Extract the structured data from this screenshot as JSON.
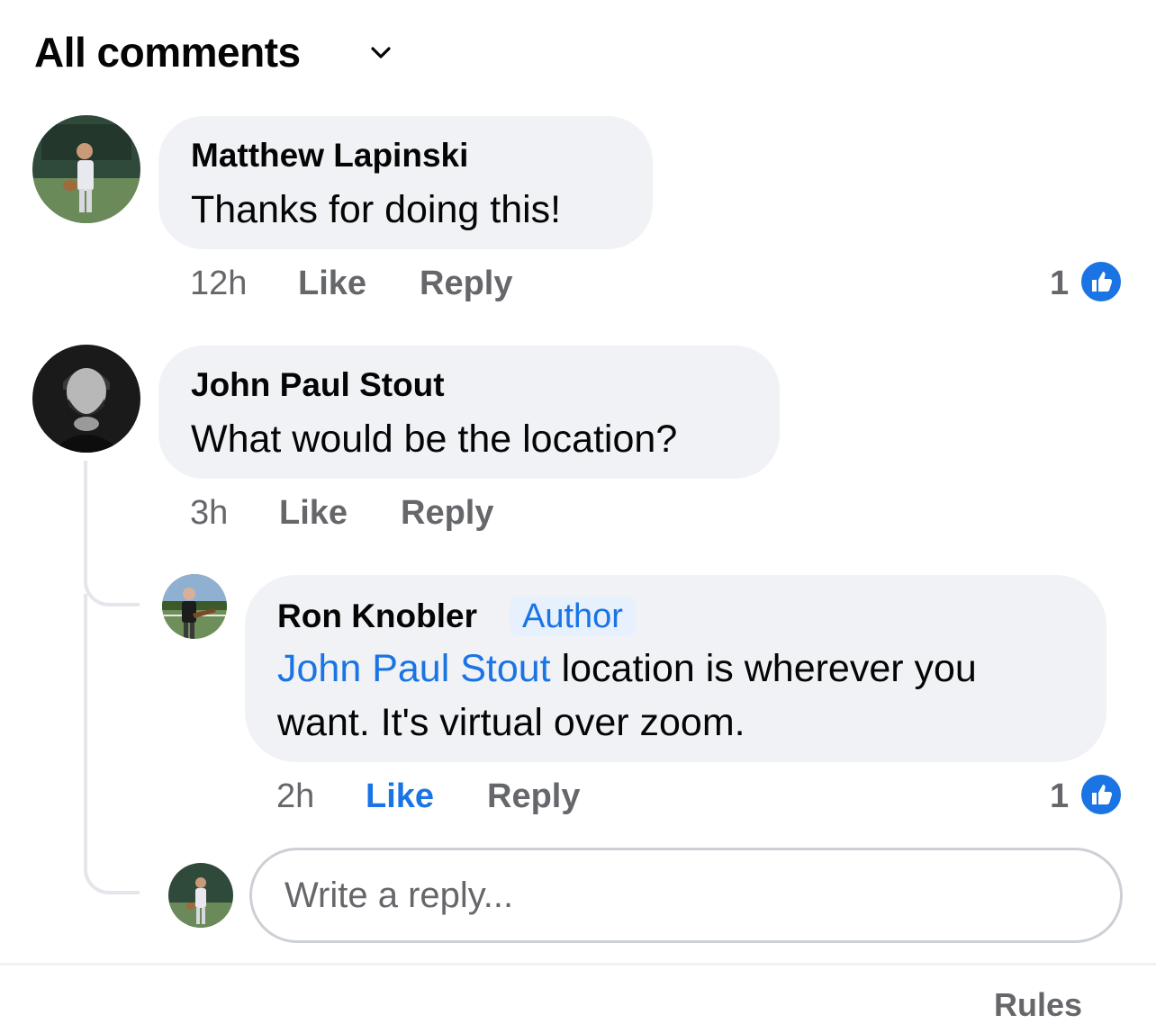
{
  "header": {
    "title": "All comments",
    "sort_icon": "chevron-down-icon"
  },
  "comments": [
    {
      "author": "Matthew Lapinski",
      "text": "Thanks for doing this!",
      "time": "12h",
      "like_label": "Like",
      "reply_label": "Reply",
      "reaction_count": "1"
    },
    {
      "author": "John Paul Stout",
      "text": "What would be the location?",
      "time": "3h",
      "like_label": "Like",
      "reply_label": "Reply",
      "replies": [
        {
          "author": "Ron Knobler",
          "badge": "Author",
          "mention": "John Paul Stout",
          "text_line1": "location is wherever you",
          "text_line2": "want. It's virtual over zoom.",
          "time": "2h",
          "like_label": "Like",
          "liked": true,
          "reply_label": "Reply",
          "reaction_count": "1"
        }
      ]
    }
  ],
  "reply_box": {
    "placeholder": "Write a reply..."
  },
  "footer": {
    "rules_label": "Rules"
  },
  "colors": {
    "accent": "#1b74e4",
    "bubble": "#f0f2f5",
    "meta": "#65676b"
  }
}
